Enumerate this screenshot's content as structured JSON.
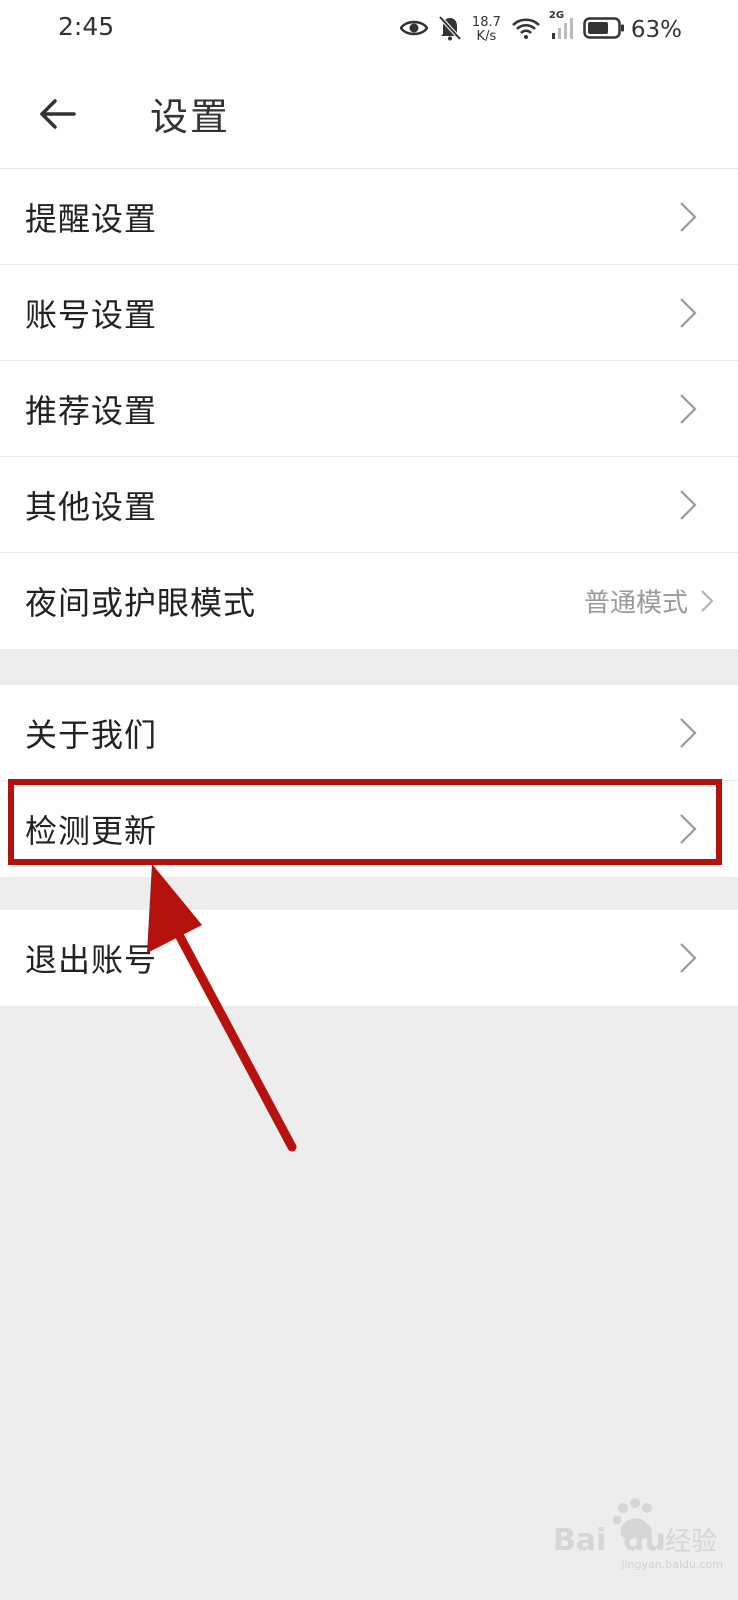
{
  "status_bar": {
    "time": "2:45",
    "net_speed_value": "18.7",
    "net_speed_unit": "K/s",
    "network_type": "2G",
    "battery_percent": "63%",
    "icons": [
      "eye-icon",
      "bell-off-icon",
      "wifi-icon",
      "signal-icon",
      "battery-icon"
    ]
  },
  "header": {
    "title": "设置",
    "back_icon": "arrow-left-icon"
  },
  "groups": [
    {
      "items": [
        {
          "label": "提醒设置"
        },
        {
          "label": "账号设置"
        },
        {
          "label": "推荐设置"
        },
        {
          "label": "其他设置"
        },
        {
          "label": "夜间或护眼模式",
          "value": "普通模式"
        }
      ]
    },
    {
      "items": [
        {
          "label": "关于我们"
        },
        {
          "label": "检测更新",
          "highlighted": true
        }
      ]
    },
    {
      "items": [
        {
          "label": "退出账号"
        }
      ]
    }
  ],
  "annotation": {
    "color": "#b5120d",
    "target": "检测更新"
  },
  "colors": {
    "background": "#ededed",
    "row_background": "#ffffff",
    "text": "#222222",
    "secondary_text": "#9a9a9a",
    "chevron": "#9a9a9a"
  },
  "watermark": {
    "brand": "Baidu经验",
    "url": "jingyan.baidu.com"
  }
}
